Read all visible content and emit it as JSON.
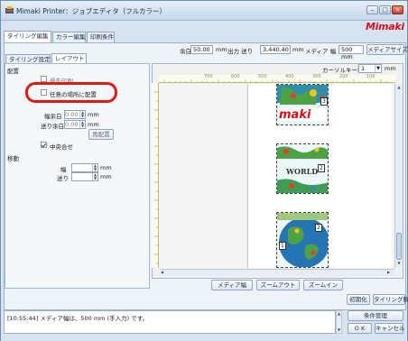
{
  "window": {
    "title": "Mimaki Printer：ジョブエディタ（フルカラー）",
    "logo": "Mimaki"
  },
  "tabs_main": [
    "タイリング編集",
    "カラー編集",
    "印刷条件"
  ],
  "tabs_sub": [
    "タイリング設定",
    "レイアウト"
  ],
  "toprow": {
    "margin_label": "余白",
    "margin_value": "50.00",
    "margin_unit": "mm",
    "output_label": "出力 送り",
    "output_value": "3,440.40",
    "output_unit": "mm",
    "media_width_label": "メディア 幅",
    "media_width_value": "500 mm",
    "media_size_button": "メディアサイズ取得"
  },
  "layout": {
    "section_label": "配置",
    "opt1_label": "優先印刷",
    "opt2_label": "任意の場所に配置",
    "row_a_label": "幅余白",
    "row_a_value": "0.00",
    "row_b_label": "送り余白",
    "row_b_value": "0.00",
    "unit": "mm",
    "rearrange_button": "再配置",
    "center_label": "中央合せ",
    "move_section_label": "移動",
    "move_width_label": "幅",
    "move_feed_label": "送り",
    "move_unit": "mm"
  },
  "preview": {
    "cursor_key_label": "カーソルキー移動量",
    "cursor_key_value": "1",
    "cursor_unit": "mm",
    "ruler_ticks": [
      "700",
      "600",
      "500",
      "400",
      "300",
      "200",
      "100"
    ],
    "tile_labels": [
      "3",
      "2",
      "1"
    ],
    "tile_texts": [
      "maki",
      "WORLD",
      ""
    ]
  },
  "bottom_buttons": {
    "media_width": "メディア幅",
    "zoom_out": "ズームアウト",
    "zoom_in": "ズームイン",
    "initialize": "初期化",
    "tiling_release": "タイリング解除",
    "condition": "条件管理",
    "ok": "O K",
    "cancel": "キャンセル"
  },
  "log": {
    "message": "[10:55:44] メディア幅は、500 mm (手入力) です。"
  },
  "colors": {
    "accent_red": "#e01a10",
    "brand_red": "#d40e1c",
    "frame_blue": "#d7e3f0"
  }
}
